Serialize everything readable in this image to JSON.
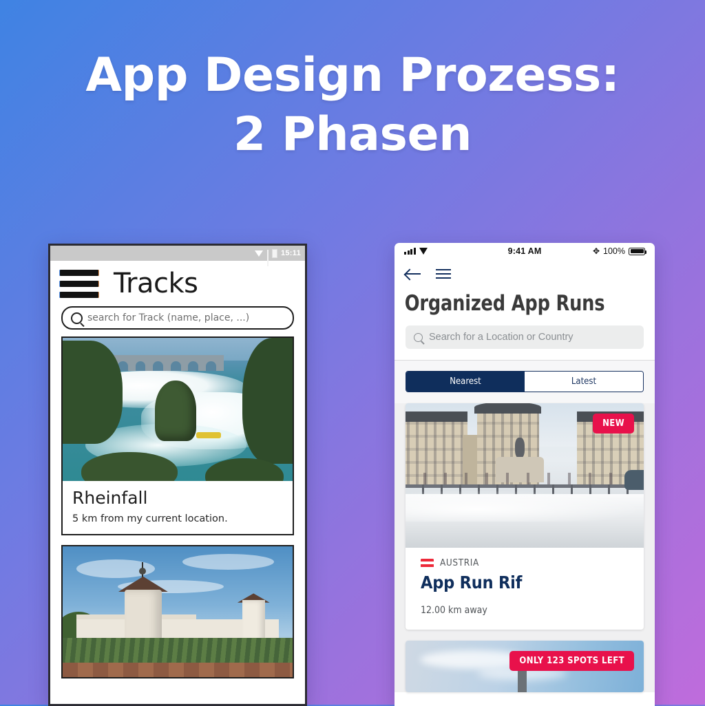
{
  "headline": {
    "line1": "App Design Prozess:",
    "line2": "2 Phasen"
  },
  "background": {
    "gradient_start": "#3f83e3",
    "gradient_end": "#bf6cdc"
  },
  "left_phone": {
    "status_bar": {
      "time": "15:11",
      "icons": [
        "wifi-icon",
        "signal-icon",
        "battery-icon"
      ]
    },
    "app_bar": {
      "menu_icon": "hamburger-icon",
      "title": "Tracks"
    },
    "search": {
      "placeholder": "search for Track (name, place, ...)",
      "icon": "search-icon"
    },
    "cards": [
      {
        "title": "Rheinfall",
        "subtitle": "5 km from my current location.",
        "image_alt": "rheinfall-waterfall-photo"
      },
      {
        "title": "",
        "subtitle": "",
        "image_alt": "munot-castle-photo"
      }
    ]
  },
  "right_phone": {
    "status_bar": {
      "time": "9:41 AM",
      "battery_percent": "100%",
      "icons": [
        "signal-icon",
        "wifi-icon",
        "bluetooth-icon",
        "battery-icon"
      ]
    },
    "nav": {
      "back_icon": "back-arrow-icon",
      "menu_icon": "hamburger-icon"
    },
    "title": "Organized App Runs",
    "search": {
      "placeholder": "Search for a Location or Country",
      "icon": "search-icon"
    },
    "segmented": {
      "options": [
        "Nearest",
        "Latest"
      ],
      "selected": "Nearest",
      "active_color": "#0f2e5c"
    },
    "cards": [
      {
        "badge": "NEW",
        "badge_color": "#e8114b",
        "country": "AUSTRIA",
        "flag": "austria-flag",
        "name": "App Run Rif",
        "distance": "12.00 km away",
        "image_alt": "bordeaux-place-de-la-bourse-photo"
      },
      {
        "badge": "ONLY 123 SPOTS LEFT",
        "badge_color": "#e8114b",
        "country": "",
        "flag": "",
        "name": "",
        "distance": "",
        "image_alt": "sky-clouds-photo"
      }
    ]
  }
}
